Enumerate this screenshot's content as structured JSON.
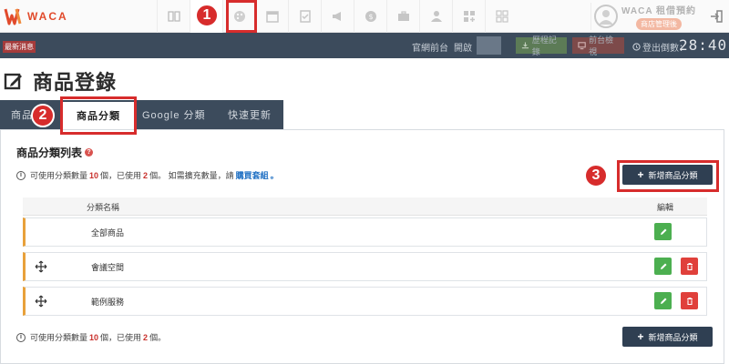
{
  "header": {
    "logo_text": "WACA",
    "brand_title": "WACA 租借預約",
    "brand_badge": "商店管理後",
    "nav_icons": [
      "book-icon",
      "edit-icon",
      "palette-icon",
      "calendar-icon",
      "check-icon",
      "megaphone-icon",
      "coin-icon",
      "briefcase-icon",
      "user-icon",
      "grid-add-icon",
      "apps-icon"
    ]
  },
  "statusbar": {
    "news_label": "最新消息",
    "site_label": "官網前台",
    "toggle_label": "開啟",
    "history_btn": "歷程記錄",
    "frontend_btn": "前台檢視",
    "logout_countdown_label": "登出倒數：",
    "countdown": "28:40"
  },
  "page": {
    "title": "商品登錄"
  },
  "tabs": [
    {
      "label": "商品"
    },
    {
      "label": "商品分類"
    },
    {
      "label": "Google 分類"
    },
    {
      "label": "快速更新"
    }
  ],
  "section": {
    "title": "商品分類列表",
    "help": "?",
    "info_prefix": "可使用分類數量",
    "info_limit": "10",
    "info_mid": "個，已使用",
    "info_used": "2",
    "info_suffix": "個。 如需擴充數量，請",
    "info_link": "購買套組",
    "info_end": "。",
    "footer_suffix": "個。",
    "info_icon": "i"
  },
  "buttons": {
    "plus": "+",
    "add_category": "新增商品分類"
  },
  "table": {
    "col_name": "分類名稱",
    "col_edit": "編輯",
    "rows": [
      {
        "name": "全部商品"
      },
      {
        "name": "會議空間"
      },
      {
        "name": "範例服務"
      }
    ]
  },
  "annotations": [
    "1",
    "2",
    "3"
  ],
  "colors": {
    "dark_navy": "#3c4b5c",
    "accent_orange": "#e8a13b",
    "edit_green": "#4caf50",
    "delete_red": "#e0403b",
    "callout_red": "#d72c2c"
  }
}
